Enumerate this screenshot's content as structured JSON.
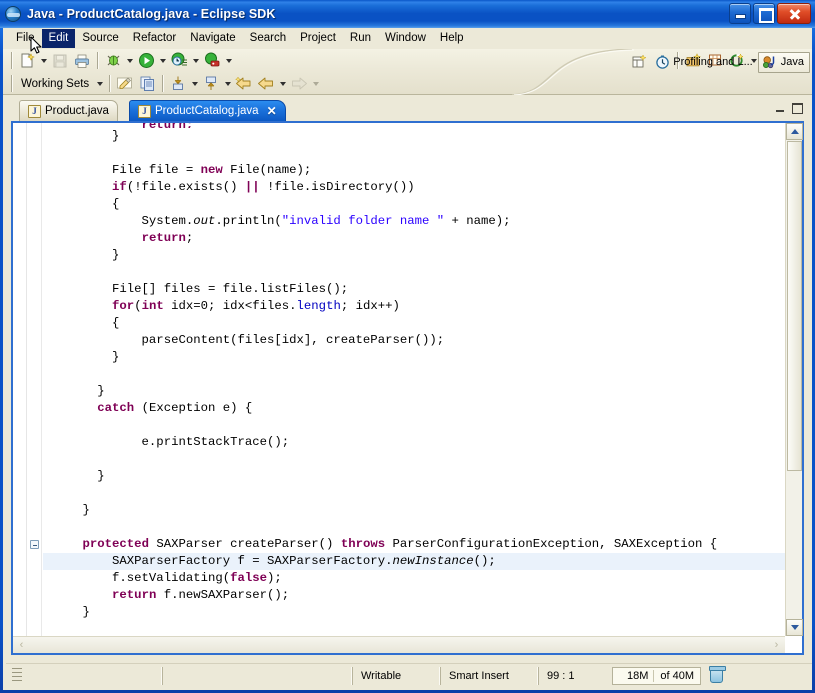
{
  "window": {
    "title": "Java - ProductCatalog.java - Eclipse SDK",
    "app_icon": "eclipse-icon",
    "controls": {
      "minimize": "Minimize",
      "maximize": "Maximize",
      "close": "Close"
    }
  },
  "menubar": {
    "items": [
      {
        "label": "File",
        "active": false
      },
      {
        "label": "Edit",
        "active": true
      },
      {
        "label": "Source",
        "active": false
      },
      {
        "label": "Refactor",
        "active": false
      },
      {
        "label": "Navigate",
        "active": false
      },
      {
        "label": "Search",
        "active": false
      },
      {
        "label": "Project",
        "active": false
      },
      {
        "label": "Run",
        "active": false
      },
      {
        "label": "Window",
        "active": false
      },
      {
        "label": "Help",
        "active": false
      }
    ]
  },
  "toolbar": {
    "row1": [
      {
        "icon": "new-wizard-icon",
        "dropdown": true
      },
      {
        "icon": "save-icon",
        "dropdown": false,
        "disabled": true
      },
      {
        "icon": "print-icon",
        "dropdown": false
      },
      {
        "icon": "debug-icon",
        "dropdown": true
      },
      {
        "icon": "run-icon",
        "dropdown": true
      },
      {
        "icon": "profile-icon",
        "dropdown": true
      },
      {
        "icon": "coverage-icon",
        "dropdown": true
      },
      {
        "icon": "new-java-package-icon",
        "dropdown": false
      },
      {
        "icon": "new-java-class-icon",
        "dropdown": false
      },
      {
        "icon": "new-java-interface-icon",
        "dropdown": true
      },
      {
        "icon": "open-type-icon",
        "dropdown": false
      },
      {
        "icon": "search-pin-icon",
        "dropdown": false
      }
    ],
    "row2": [
      {
        "icon": "working-sets-label",
        "label": "Working Sets",
        "dropdown": true
      },
      {
        "icon": "pencil-edit-icon",
        "dropdown": false
      },
      {
        "icon": "copy-icon",
        "dropdown": false
      },
      {
        "icon": "next-annotation-icon",
        "dropdown": true
      },
      {
        "icon": "previous-annotation-icon",
        "dropdown": true
      },
      {
        "icon": "last-edit-location-icon",
        "dropdown": false
      },
      {
        "icon": "back-icon",
        "dropdown": true
      },
      {
        "icon": "forward-icon",
        "dropdown": true,
        "disabled": true
      }
    ],
    "working_sets_label": "Working Sets"
  },
  "perspectives": {
    "open_perspective_icon": "open-perspective-icon",
    "items": [
      {
        "label": "Profiling and L...",
        "icon": "profiling-perspective-icon",
        "active": false
      },
      {
        "label": "Java",
        "icon": "java-perspective-icon",
        "active": true
      }
    ]
  },
  "editor": {
    "tabs": [
      {
        "label": "Product.java",
        "icon": "java-file-icon",
        "active": false,
        "closable": false
      },
      {
        "label": "ProductCatalog.java",
        "icon": "java-file-icon",
        "active": true,
        "closable": true,
        "close_label": "✕"
      }
    ],
    "part_controls": {
      "minimize": "Minimize",
      "maximize": "Maximize"
    },
    "fold_marker": "collapse-marker",
    "scroll": {
      "vertical_up": "▲",
      "vertical_down": "▼",
      "horizontal_left": "‹",
      "horizontal_right": "›"
    },
    "code_lines": [
      {
        "indent": 0,
        "highlight": false,
        "clipped": true,
        "tokens": [
          {
            "t": "            return;",
            "c": "kw"
          }
        ]
      },
      {
        "indent": 0,
        "highlight": false,
        "tokens": [
          {
            "t": "        }",
            "c": ""
          }
        ]
      },
      {
        "indent": 0,
        "highlight": false,
        "tokens": [
          {
            "t": "",
            "c": ""
          }
        ]
      },
      {
        "indent": 0,
        "highlight": false,
        "tokens": [
          {
            "t": "        File file = ",
            "c": ""
          },
          {
            "t": "new",
            "c": "kw"
          },
          {
            "t": " File(name);",
            "c": ""
          }
        ]
      },
      {
        "indent": 0,
        "highlight": false,
        "tokens": [
          {
            "t": "        ",
            "c": ""
          },
          {
            "t": "if",
            "c": "kw"
          },
          {
            "t": "(!file.exists() ",
            "c": ""
          },
          {
            "t": "||",
            "c": "kw"
          },
          {
            "t": " !file.isDirectory())",
            "c": ""
          }
        ]
      },
      {
        "indent": 0,
        "highlight": false,
        "tokens": [
          {
            "t": "        {",
            "c": ""
          }
        ]
      },
      {
        "indent": 0,
        "highlight": false,
        "tokens": [
          {
            "t": "            System.",
            "c": ""
          },
          {
            "t": "out",
            "c": "stm"
          },
          {
            "t": ".println(",
            "c": ""
          },
          {
            "t": "\"invalid folder name \"",
            "c": "str"
          },
          {
            "t": " + name);",
            "c": ""
          }
        ]
      },
      {
        "indent": 0,
        "highlight": false,
        "tokens": [
          {
            "t": "            ",
            "c": ""
          },
          {
            "t": "return",
            "c": "kw"
          },
          {
            "t": ";",
            "c": ""
          }
        ]
      },
      {
        "indent": 0,
        "highlight": false,
        "tokens": [
          {
            "t": "        }",
            "c": ""
          }
        ]
      },
      {
        "indent": 0,
        "highlight": false,
        "tokens": [
          {
            "t": "",
            "c": ""
          }
        ]
      },
      {
        "indent": 0,
        "highlight": false,
        "tokens": [
          {
            "t": "        File[] files = file.listFiles();",
            "c": ""
          }
        ]
      },
      {
        "indent": 0,
        "highlight": false,
        "tokens": [
          {
            "t": "        ",
            "c": ""
          },
          {
            "t": "for",
            "c": "kw"
          },
          {
            "t": "(",
            "c": ""
          },
          {
            "t": "int",
            "c": "kw"
          },
          {
            "t": " idx=0; idx<files.",
            "c": ""
          },
          {
            "t": "length",
            "c": "fld"
          },
          {
            "t": "; idx++)",
            "c": ""
          }
        ]
      },
      {
        "indent": 0,
        "highlight": false,
        "tokens": [
          {
            "t": "        {",
            "c": ""
          }
        ]
      },
      {
        "indent": 0,
        "highlight": false,
        "tokens": [
          {
            "t": "            parseContent(files[idx], createParser());",
            "c": ""
          }
        ]
      },
      {
        "indent": 0,
        "highlight": false,
        "tokens": [
          {
            "t": "        }",
            "c": ""
          }
        ]
      },
      {
        "indent": 0,
        "highlight": false,
        "tokens": [
          {
            "t": "",
            "c": ""
          }
        ]
      },
      {
        "indent": 0,
        "highlight": false,
        "tokens": [
          {
            "t": "      }",
            "c": ""
          }
        ]
      },
      {
        "indent": 0,
        "highlight": false,
        "tokens": [
          {
            "t": "      ",
            "c": ""
          },
          {
            "t": "catch",
            "c": "kw"
          },
          {
            "t": " (Exception e) {",
            "c": ""
          }
        ]
      },
      {
        "indent": 0,
        "highlight": false,
        "tokens": [
          {
            "t": "",
            "c": ""
          }
        ]
      },
      {
        "indent": 0,
        "highlight": false,
        "tokens": [
          {
            "t": "            e.printStackTrace();",
            "c": ""
          }
        ]
      },
      {
        "indent": 0,
        "highlight": false,
        "tokens": [
          {
            "t": "",
            "c": ""
          }
        ]
      },
      {
        "indent": 0,
        "highlight": false,
        "tokens": [
          {
            "t": "      }",
            "c": ""
          }
        ]
      },
      {
        "indent": 0,
        "highlight": false,
        "tokens": [
          {
            "t": "",
            "c": ""
          }
        ]
      },
      {
        "indent": 0,
        "highlight": false,
        "tokens": [
          {
            "t": "    }",
            "c": ""
          }
        ]
      },
      {
        "indent": 0,
        "highlight": false,
        "tokens": [
          {
            "t": "",
            "c": ""
          }
        ]
      },
      {
        "indent": 0,
        "highlight": false,
        "fold": true,
        "tokens": [
          {
            "t": "    ",
            "c": ""
          },
          {
            "t": "protected",
            "c": "kw"
          },
          {
            "t": " SAXParser createParser() ",
            "c": ""
          },
          {
            "t": "throws",
            "c": "kw"
          },
          {
            "t": " ParserConfigurationException, SAXException {",
            "c": ""
          }
        ]
      },
      {
        "indent": 0,
        "highlight": true,
        "tokens": [
          {
            "t": "        SAXParserFactory f = SAXParserFactory.",
            "c": ""
          },
          {
            "t": "newInstance",
            "c": "stm"
          },
          {
            "t": "();",
            "c": ""
          }
        ]
      },
      {
        "indent": 0,
        "highlight": false,
        "tokens": [
          {
            "t": "        f.setValidating(",
            "c": ""
          },
          {
            "t": "false",
            "c": "kw"
          },
          {
            "t": ");",
            "c": ""
          }
        ]
      },
      {
        "indent": 0,
        "highlight": false,
        "tokens": [
          {
            "t": "        ",
            "c": ""
          },
          {
            "t": "return",
            "c": "kw"
          },
          {
            "t": " f.newSAXParser();",
            "c": ""
          }
        ]
      },
      {
        "indent": 0,
        "highlight": false,
        "tokens": [
          {
            "t": "    }",
            "c": ""
          }
        ]
      }
    ]
  },
  "statusbar": {
    "writable": "Writable",
    "insert_mode": "Smart Insert",
    "position": "99 : 1",
    "memory_used": "18M",
    "memory_total": "of 40M",
    "gc_icon": "trash-icon"
  },
  "colors": {
    "title_blue": "#0a52c4",
    "chrome": "#ece9d8",
    "tab_active": "#1d74dd",
    "keyword": "#7f0055",
    "string": "#2a00ff",
    "field": "#0000c0",
    "line_highlight": "#eaf2fb",
    "close_red": "#c02a10"
  }
}
